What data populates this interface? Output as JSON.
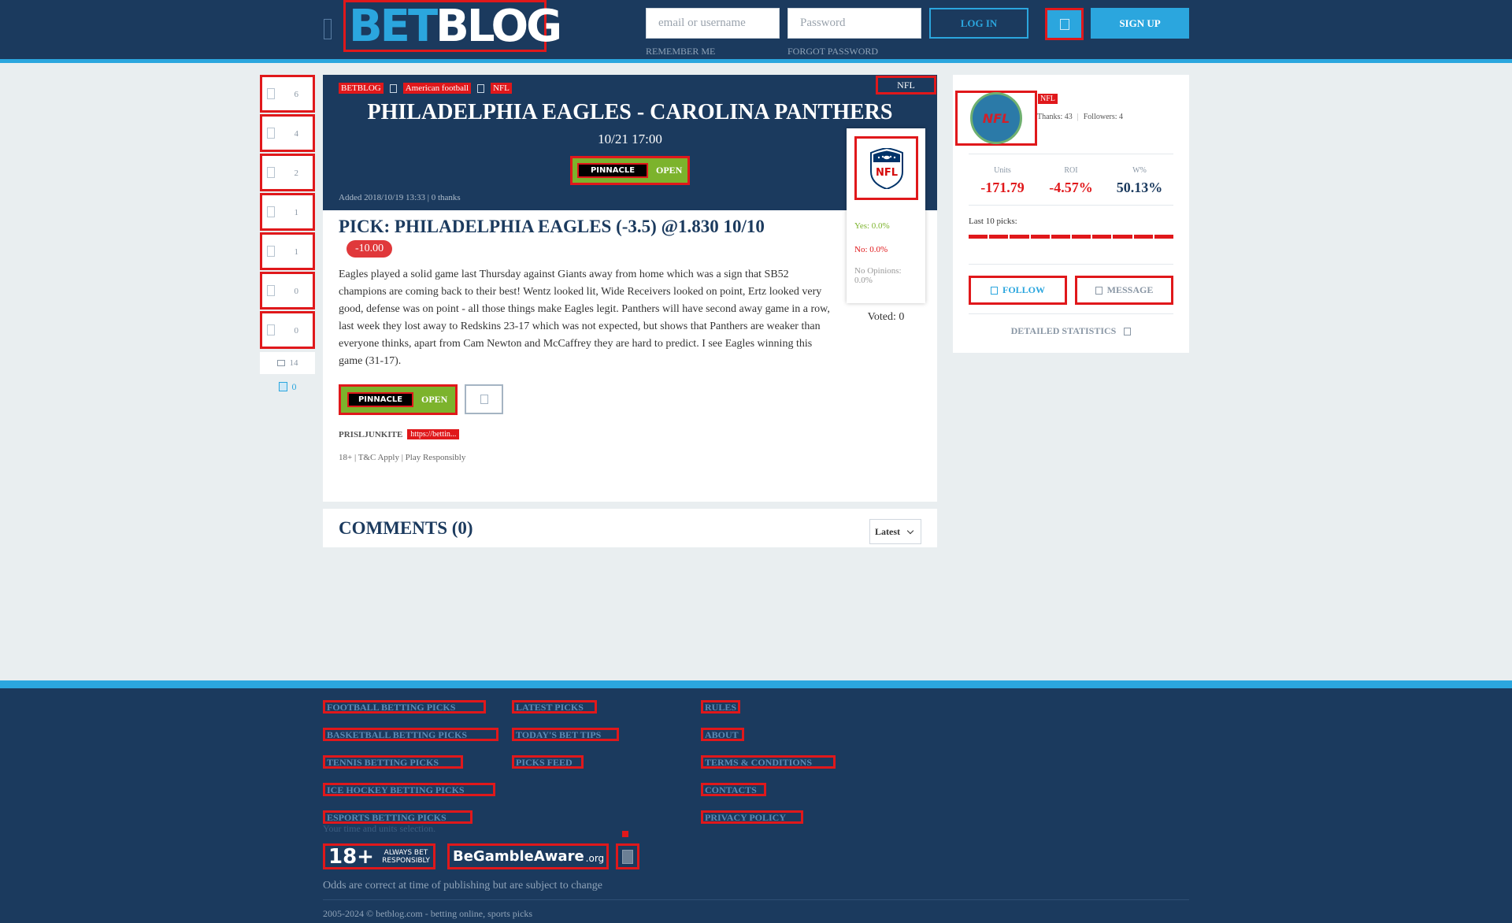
{
  "header": {
    "logo_bet": "BET",
    "logo_blog": "BLOG",
    "username_placeholder": "email or username",
    "password_placeholder": "Password",
    "login_label": "LOG IN",
    "signup_label": "SIGN UP",
    "remember_label": "REMEMBER ME",
    "forgot_label": "FORGOT PASSWORD",
    "facebook_icon": "facebook-icon"
  },
  "rail": {
    "counts": [
      "6",
      "4",
      "2",
      "1",
      "1",
      "0",
      "0"
    ],
    "comments_count": "14",
    "share_count": "0"
  },
  "post": {
    "breadcrumbs": [
      "BETBLOG",
      "American football",
      "NFL"
    ],
    "league_tag": "NFL",
    "title": "PHILADELPHIA EAGLES - CAROLINA PANTHERS",
    "date": "10/21 17:00",
    "bookmaker": "PINNACLE",
    "bookmaker_status": "OPEN",
    "added": "Added 2018/10/19 13:33 | 0 thanks",
    "pick": "PICK: PHILADELPHIA EAGLES (-3.5) @1.830 10/10",
    "result_badge": "-10.00",
    "description": "Eagles played a solid game last Thursday against Giants away from home which was a sign that SB52 champions are coming back to their best! Wentz looked lit, Wide Receivers looked on point, Ertz looked very good, defense was on point - all those things make Eagles legit. Panthers will have second away game in a row, last week they lost away to Redskins 23-17 which was not expected, but shows that Panthers are weaker than everyone thinks, apart from Cam Newton and McCaffrey they are hard to predict. I see Eagles winning this game (31-17).",
    "prisl_label": "PRISLJUNKITE",
    "prisl_tag": "https://bettin...",
    "disclaimer": "18+ | T&C Apply | Play Responsibly"
  },
  "vote": {
    "yes": "Yes: 0.0%",
    "no": "No: 0.0%",
    "none": "No Opinions: 0.0%",
    "voted": "Voted: 0"
  },
  "comments": {
    "title": "COMMENTS (0)",
    "sort": "Latest"
  },
  "profile": {
    "avatar_text": "NFL",
    "name": "NFL",
    "thanks": "Thanks: 43",
    "followers": "Followers: 4",
    "stats": [
      {
        "label": "Units",
        "value": "-171.79",
        "color": "#e0181b"
      },
      {
        "label": "ROI",
        "value": "-4.57%",
        "color": "#e0181b"
      },
      {
        "label": "W%",
        "value": "50.13%",
        "color": "#1b3a5e"
      }
    ],
    "last10_label": "Last 10 picks:",
    "follow_label": "FOLLOW",
    "message_label": "MESSAGE",
    "detailed_label": "DETAILED STATISTICS"
  },
  "footer": {
    "col1": [
      "FOOTBALL BETTING PICKS",
      "BASKETBALL BETTING PICKS",
      "TENNIS BETTING PICKS",
      "ICE HOCKEY BETTING PICKS",
      "ESPORTS BETTING PICKS"
    ],
    "col2": [
      "LATEST PICKS",
      "TODAY'S BET TIPS",
      "PICKS FEED"
    ],
    "col3": [
      "RULES",
      "ABOUT",
      "TERMS & CONDITIONS",
      "CONTACTS",
      "PRIVACY POLICY"
    ],
    "time_note": "Your time and units selection.",
    "badge18_num": "18+",
    "badge18_text": "ALWAYS BET RESPONSIBLY",
    "gamble_text": "BeGambleAware",
    "gamble_org": ".org",
    "odds_note": "Odds are correct at time of publishing but are subject to change",
    "copyright": "2005-2024 © betblog.com - betting online, sports picks"
  },
  "colors": {
    "navy": "#1b3a5e",
    "accent": "#2ba6de",
    "green": "#7cb32c",
    "red": "#e0181b"
  }
}
